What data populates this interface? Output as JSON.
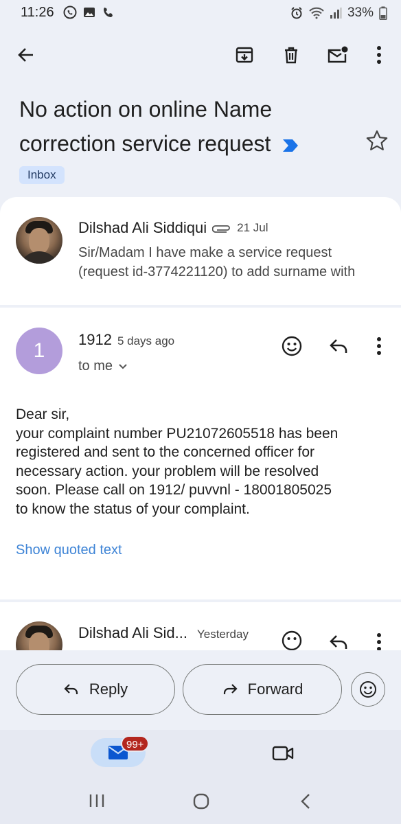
{
  "status_bar": {
    "time": "11:26",
    "battery": "33%"
  },
  "email": {
    "subject": "No action on online Name correction service request",
    "label": "Inbox"
  },
  "messages": [
    {
      "sender": "Dilshad Ali Siddiqui",
      "date": "21 Jul",
      "snippet_line1": "Sir/Madam I have make a service request",
      "snippet_line2": "(request id-3774221120) to add surname with"
    },
    {
      "avatar_letter": "1",
      "sender": "1912",
      "date": "5 days ago",
      "recipient": "to me",
      "body": [
        "Dear sir,",
        "your complaint number PU21072605518 has been",
        "registered and sent to the concerned officer for",
        "necessary action. your problem will be resolved",
        "soon. Please call on 1912/ puvvnl - 18001805025",
        "to know the status of your complaint."
      ],
      "show_quoted": "Show quoted text"
    },
    {
      "sender": "Dilshad Ali Sid...",
      "date": "Yesterday"
    }
  ],
  "actions": {
    "reply": "Reply",
    "forward": "Forward"
  },
  "bottom_nav": {
    "mail_badge": "99+"
  },
  "colors": {
    "accent_blue": "#3e84d6",
    "label_bg": "#d3e3fd",
    "avatar_purple": "#b39ddb",
    "badge_red": "#b3261e"
  }
}
